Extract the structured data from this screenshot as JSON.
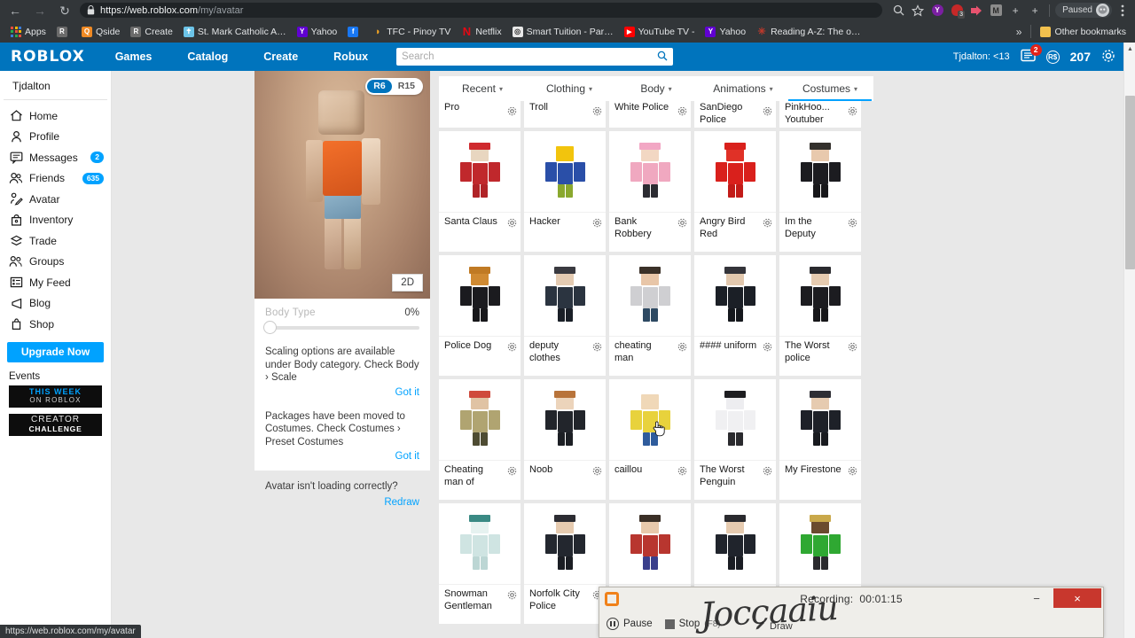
{
  "browser": {
    "nav": {
      "back": "←",
      "forward": "→",
      "reload": "↻"
    },
    "url_secure": "https://web.roblox.com",
    "url_path": "/my/avatar",
    "lock_icon": "lock-icon",
    "toolbar_icons": [
      "search-icon",
      "bookmark-star-icon",
      "extension-yahoo-icon",
      "extension-red-icon",
      "extension-arrow-icon",
      "extension-gmail-icon",
      "add-icon",
      "new-tab-icon"
    ],
    "extension_badge": "3",
    "profile_label": "Paused",
    "menu_icon": "kebab-menu-icon",
    "bookmarks": [
      {
        "label": "Apps",
        "icon": "apps-grid-icon",
        "color": "#ffffff"
      },
      {
        "label": "",
        "icon": "roblox-favicon",
        "color": "#6b6b6b"
      },
      {
        "label": "Qside",
        "icon": "qside-favicon",
        "color": "#f08a24"
      },
      {
        "label": "Create",
        "icon": "roblox-favicon",
        "color": "#6b6b6b"
      },
      {
        "label": "St. Mark Catholic A…",
        "icon": "church-favicon",
        "color": "#6cc4e8"
      },
      {
        "label": "Yahoo",
        "icon": "yahoo-favicon",
        "color": "#6001d2"
      },
      {
        "label": "",
        "icon": "facebook-favicon",
        "color": "#1877f2"
      },
      {
        "label": "TFC - Pinoy TV",
        "icon": "tfc-favicon",
        "color": "#f5a623"
      },
      {
        "label": "Netflix",
        "icon": "netflix-favicon",
        "color": "#e50914"
      },
      {
        "label": "Smart Tuition - Par…",
        "icon": "smart-tuition-favicon",
        "color": "#2b2b2b"
      },
      {
        "label": "YouTube TV -",
        "icon": "youtube-favicon",
        "color": "#ff0000"
      },
      {
        "label": "Yahoo",
        "icon": "yahoo-favicon",
        "color": "#6001d2"
      },
      {
        "label": "Reading A-Z: The o…",
        "icon": "readingaz-favicon",
        "color": "#c0392b"
      }
    ],
    "overflow_label": "»",
    "other_bookmarks": "Other bookmarks",
    "status_url": "https://web.roblox.com/my/avatar"
  },
  "roblox_header": {
    "logo": "ROBLOX",
    "nav": [
      "Games",
      "Catalog",
      "Create",
      "Robux"
    ],
    "search_placeholder": "Search",
    "search_icon": "search-icon",
    "username": "Tjdalton: <13",
    "messages_icon": "messages-icon",
    "messages_badge": "2",
    "robux_icon": "robux-icon",
    "robux_amount": "207",
    "settings_icon": "gear-icon",
    "brand_color": "#0074bd"
  },
  "sidebar": {
    "user": "Tjdalton",
    "items": [
      {
        "label": "Home",
        "icon": "home-icon",
        "badge": ""
      },
      {
        "label": "Profile",
        "icon": "person-icon",
        "badge": ""
      },
      {
        "label": "Messages",
        "icon": "chat-icon",
        "badge": "2"
      },
      {
        "label": "Friends",
        "icon": "friends-icon",
        "badge": "635"
      },
      {
        "label": "Avatar",
        "icon": "avatar-icon",
        "badge": ""
      },
      {
        "label": "Inventory",
        "icon": "backpack-icon",
        "badge": ""
      },
      {
        "label": "Trade",
        "icon": "trade-icon",
        "badge": ""
      },
      {
        "label": "Groups",
        "icon": "groups-icon",
        "badge": ""
      },
      {
        "label": "My Feed",
        "icon": "feed-icon",
        "badge": ""
      },
      {
        "label": "Blog",
        "icon": "megaphone-icon",
        "badge": ""
      },
      {
        "label": "Shop",
        "icon": "bag-icon",
        "badge": ""
      }
    ],
    "upgrade_button": "Upgrade Now",
    "events_label": "Events",
    "promos": [
      {
        "line1": "THIS WEEK",
        "line2": "ON ROBLOX"
      },
      {
        "line1": "CREATOR",
        "line2": "CHALLENGE"
      }
    ],
    "badge_color": "#00a2ff"
  },
  "avatar_panel": {
    "rig_r6": "R6",
    "rig_r15": "R15",
    "rig_selected": "R6",
    "view_2d": "2D",
    "body_type_label": "Body Type",
    "body_type_value": "0%",
    "body_type_percent": 0,
    "notices": [
      {
        "text": "Scaling options are available under Body category. Check Body › Scale",
        "action": "Got it"
      },
      {
        "text": "Packages have been moved to Costumes. Check Costumes › Preset Costumes",
        "action": "Got it"
      }
    ],
    "redraw_question": "Avatar isn't loading correctly?",
    "redraw_link": "Redraw"
  },
  "tabs": [
    {
      "label": "Recent",
      "active": false,
      "chevron": "chevron-down-icon"
    },
    {
      "label": "Clothing",
      "active": false,
      "chevron": "chevron-down-icon"
    },
    {
      "label": "Body",
      "active": false,
      "chevron": "chevron-down-icon"
    },
    {
      "label": "Animations",
      "active": false,
      "chevron": "chevron-down-icon"
    },
    {
      "label": "Costumes",
      "active": true,
      "chevron": "chevron-down-icon"
    }
  ],
  "grid": {
    "clipped_row": [
      {
        "name": "Pro"
      },
      {
        "name": "Troll"
      },
      {
        "name": "White Police"
      },
      {
        "name": "SanDiego Police"
      },
      {
        "name": "PinkHoo... Youtuber"
      }
    ],
    "items": [
      {
        "name": "Santa Claus",
        "shirt": "#c0282c",
        "pants": "#b02327",
        "skin": "#e8d6c0",
        "hat": "#cf2a2e",
        "hat_on": true
      },
      {
        "name": "Hacker",
        "shirt": "#2a4fa8",
        "pants": "#8aa82e",
        "skin": "#f2c40d",
        "hat": "",
        "hat_on": false
      },
      {
        "name": "Bank Robbery",
        "shirt": "#f0a8c0",
        "pants": "#2c2c32",
        "skin": "#f2d7c3",
        "hat": "#f2a7c4",
        "hat_on": true
      },
      {
        "name": "Angry Bird Red",
        "shirt": "#d9201c",
        "pants": "#c21b18",
        "skin": "#e03127",
        "hat": "#d9201c",
        "hat_on": true
      },
      {
        "name": "Im the Deputy",
        "shirt": "#1c1c20",
        "pants": "#17171a",
        "skin": "#e8c9ad",
        "hat": "#33302c",
        "hat_on": true
      },
      {
        "name": "Police Dog",
        "shirt": "#1b1b1f",
        "pants": "#17171a",
        "skin": "#d08a32",
        "hat": "#c07a24",
        "hat_on": true
      },
      {
        "name": "deputy clothes",
        "shirt": "#2b3440",
        "pants": "#1a1f27",
        "skin": "#e4cbb2",
        "hat": "#3a3a40",
        "hat_on": true
      },
      {
        "name": "cheating man",
        "shirt": "#cfcfd2",
        "pants": "#2e4a63",
        "skin": "#e8c6a8",
        "hat": "#3b3128",
        "hat_on": true
      },
      {
        "name": "#### uniform",
        "shirt": "#1b1f26",
        "pants": "#15181d",
        "skin": "#e2c8ae",
        "hat": "#34343a",
        "hat_on": true
      },
      {
        "name": "The Worst police",
        "shirt": "#1c1c20",
        "pants": "#17171a",
        "skin": "#e6cbb0",
        "hat": "#2a2a2e",
        "hat_on": true
      },
      {
        "name": "Cheating man of",
        "shirt": "#b0a471",
        "pants": "#4e4c33",
        "skin": "#e0c3a4",
        "hat": "#cf4a3c",
        "hat_on": true
      },
      {
        "name": "Noob",
        "shirt": "#22252b",
        "pants": "#1c1f24",
        "skin": "#ecd4bb",
        "hat": "#b8733a",
        "hat_on": true
      },
      {
        "name": "caillou",
        "shirt": "#e8d23c",
        "pants": "#2f5c9c",
        "skin": "#f0d8b8",
        "hat": "",
        "hat_on": false
      },
      {
        "name": "The Worst Penguin",
        "shirt": "#f0f0f2",
        "pants": "#2a2a2e",
        "skin": "#ededf0",
        "hat": "#1d1d20",
        "hat_on": true
      },
      {
        "name": "My Firestone",
        "shirt": "#1e2128",
        "pants": "#181a1f",
        "skin": "#e6cbb0",
        "hat": "#2e2e34",
        "hat_on": true
      },
      {
        "name": "Snowman Gentleman",
        "shirt": "#cfe4e2",
        "pants": "#bcd6d4",
        "skin": "#e6f2f0",
        "hat": "#3a8a84",
        "hat_on": true
      },
      {
        "name": "Norfolk City Police",
        "shirt": "#23272f",
        "pants": "#1b1e24",
        "skin": "#e6cbb0",
        "hat": "#2c2c32",
        "hat_on": true
      },
      {
        "name": "",
        "shirt": "#b8362f",
        "pants": "#3a3f8c",
        "skin": "#e8c9ab",
        "hat": "#3a2f26",
        "hat_on": true
      },
      {
        "name": "",
        "shirt": "#20242c",
        "pants": "#1a1d23",
        "skin": "#e6cbb0",
        "hat": "#2a2a2e",
        "hat_on": true
      },
      {
        "name": "",
        "shirt": "#2fa832",
        "pants": "#2a2a2e",
        "skin": "#6b4a2e",
        "hat": "#c9a84a",
        "hat_on": true
      }
    ],
    "gear_icon": "gear-icon"
  },
  "recording_bar": {
    "app_icon": "camtasia-recorder-icon",
    "title_prefix": "Recording:",
    "time": "00:01:15",
    "minimize": "−",
    "close": "×",
    "pause_label": "Pause",
    "pause_icon": "pause-icon",
    "stop_label": "Stop",
    "stop_shortcut": "(F8)",
    "stop_icon": "stop-icon",
    "draw_label": "Draw",
    "draw_icon": "pencil-icon",
    "watermark": "Joccaaiu"
  }
}
